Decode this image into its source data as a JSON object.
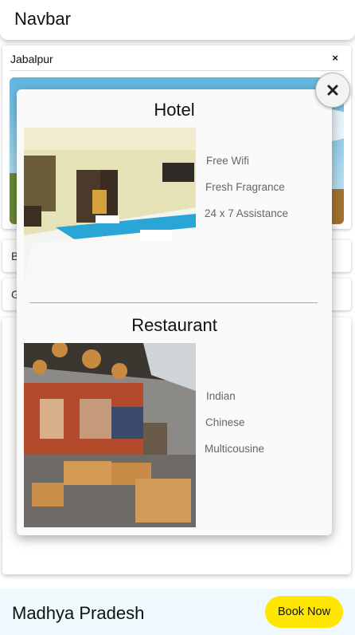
{
  "navbar": {
    "title": "Navbar"
  },
  "city_card": {
    "name": "Jabalpur",
    "close_symbol": "×"
  },
  "side_items": [
    "B",
    "G"
  ],
  "modal": {
    "hotel": {
      "title": "Hotel",
      "features": [
        "Free Wifi",
        "Fresh Fragrance",
        "24 x 7 Assistance"
      ]
    },
    "restaurant": {
      "title": "Restaurant",
      "features": [
        "Indian",
        "Chinese",
        "Multicousine"
      ]
    }
  },
  "footer": {
    "state": "Madhya Pradesh",
    "book_label": "Book Now"
  },
  "colors": {
    "accent": "#ffe600",
    "footer_bg": "#eef8fd"
  }
}
